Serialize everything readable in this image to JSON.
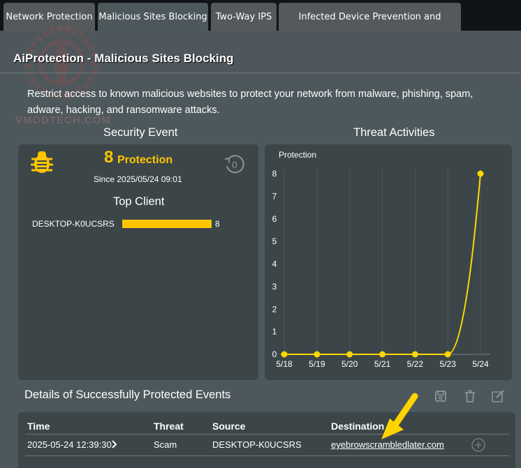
{
  "tabs": [
    {
      "label": "Network Protection"
    },
    {
      "label": "Malicious Sites Blocking"
    },
    {
      "label": "Two-Way IPS"
    },
    {
      "label": "Infected Device Prevention and Blocking"
    }
  ],
  "page": {
    "title": "AiProtection - Malicious Sites Blocking",
    "description": "Restrict access to known malicious websites to protect your network from malware, phishing, spam, adware, hacking, and ransomware attacks."
  },
  "watermark": "VMODTECH.COM",
  "security_event": {
    "title": "Security Event",
    "count": "8",
    "count_label": "Protection",
    "since": "Since 2025/05/24 09:01",
    "refresh_count": "0",
    "top_client_title": "Top Client",
    "clients": [
      {
        "name": "DESKTOP-K0UCSRS",
        "value": "8",
        "fraction": 1.0
      }
    ]
  },
  "threat_activities": {
    "title": "Threat Activities"
  },
  "chart_data": {
    "type": "line",
    "title": "",
    "series": [
      {
        "name": "Protection",
        "values": [
          0,
          0,
          0,
          0,
          0,
          0,
          8
        ]
      }
    ],
    "categories": [
      "5/18",
      "5/19",
      "5/20",
      "5/21",
      "5/22",
      "5/23",
      "5/24"
    ],
    "y_ticks": [
      "0",
      "1",
      "2",
      "3",
      "4",
      "5",
      "6",
      "7",
      "8"
    ],
    "ylim": [
      0,
      8
    ],
    "xlabel": "",
    "ylabel": "",
    "legend": "top-left",
    "color": "#ffd700",
    "grid": "vertical"
  },
  "details": {
    "title": "Details of Successfully Protected Events",
    "columns": [
      "Time",
      "Threat",
      "Source",
      "Destination"
    ],
    "rows": [
      {
        "time": "2025-05-24 12:39:30",
        "threat": "Scam",
        "source": "DESKTOP-K0UCSRS",
        "destination": "eyebrowscrambledlater.com"
      }
    ]
  }
}
